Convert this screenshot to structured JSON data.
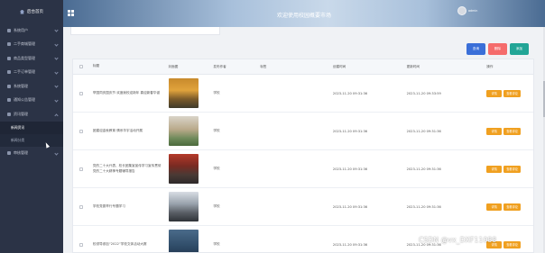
{
  "app": {
    "brand": "后台首页",
    "header_title": "欢迎使用校园概要市场",
    "username": "admin"
  },
  "sidebar": {
    "items": [
      {
        "label": "系统用户",
        "icon": "user-icon"
      },
      {
        "label": "二手商城管理",
        "icon": "store-icon"
      },
      {
        "label": "商品类型管理",
        "icon": "grid-icon"
      },
      {
        "label": "二手订单管理",
        "icon": "order-icon"
      },
      {
        "label": "系统管理",
        "icon": "settings-icon"
      },
      {
        "label": "通知公告管理",
        "icon": "notice-icon"
      },
      {
        "label": "资讯管理",
        "icon": "news-icon"
      }
    ],
    "sub_items": [
      {
        "label": "新闻资讯",
        "active": true
      },
      {
        "label": "新闻分类",
        "active": false
      }
    ],
    "last_item": {
      "label": "审核管理",
      "icon": "audit-icon"
    }
  },
  "toolbar": {
    "search_label": "查询",
    "delete_label": "删除",
    "add_label": "添加"
  },
  "table": {
    "columns": [
      "标题",
      "封面图",
      "发布作者",
      "标签",
      "创建时间",
      "更新时间",
      "操作"
    ],
    "rows": [
      {
        "title": "举国同庆国庆节 欢度我校迎新年 喜迎新春华诞",
        "author": "学校",
        "tag": "",
        "created": "2023-11-20 09:31:36",
        "updated": "2023-11-20 09:33:59",
        "thumb": "t1"
      },
      {
        "title": "团建迎金秋教育 情系华宇活动开展",
        "author": "学校",
        "tag": "",
        "created": "2023-11-20 09:31:36",
        "updated": "2023-11-20 09:31:36",
        "thumb": "t2"
      },
      {
        "title": "党的二十大代表、校长团集宣宣传学习宣传贯彻党的二十大精神专题辅导报告",
        "author": "学校",
        "tag": "",
        "created": "2023-11-20 09:31:36",
        "updated": "2023-11-20 09:31:36",
        "thumb": "t3"
      },
      {
        "title": "学校党委举行专题学习",
        "author": "学校",
        "tag": "",
        "created": "2023-11-20 09:31:36",
        "updated": "2023-11-20 09:31:36",
        "thumb": "t4"
      },
      {
        "title": "校领导参加“2022”学校文体活动大赛",
        "author": "学校",
        "tag": "",
        "created": "2023-11-20 09:31:36",
        "updated": "2023-11-20 09:31:36",
        "thumb": "t5"
      }
    ],
    "action_detail": "详情",
    "action_review": "查看评论"
  },
  "watermark": "CSDN @vx_DXF11088",
  "colors": {
    "sidebar_bg": "#2b3346",
    "search_btn": "#3a6fd8",
    "delete_btn": "#f56c6c",
    "add_btn": "#22a596",
    "action_btn": "#f0a020"
  }
}
